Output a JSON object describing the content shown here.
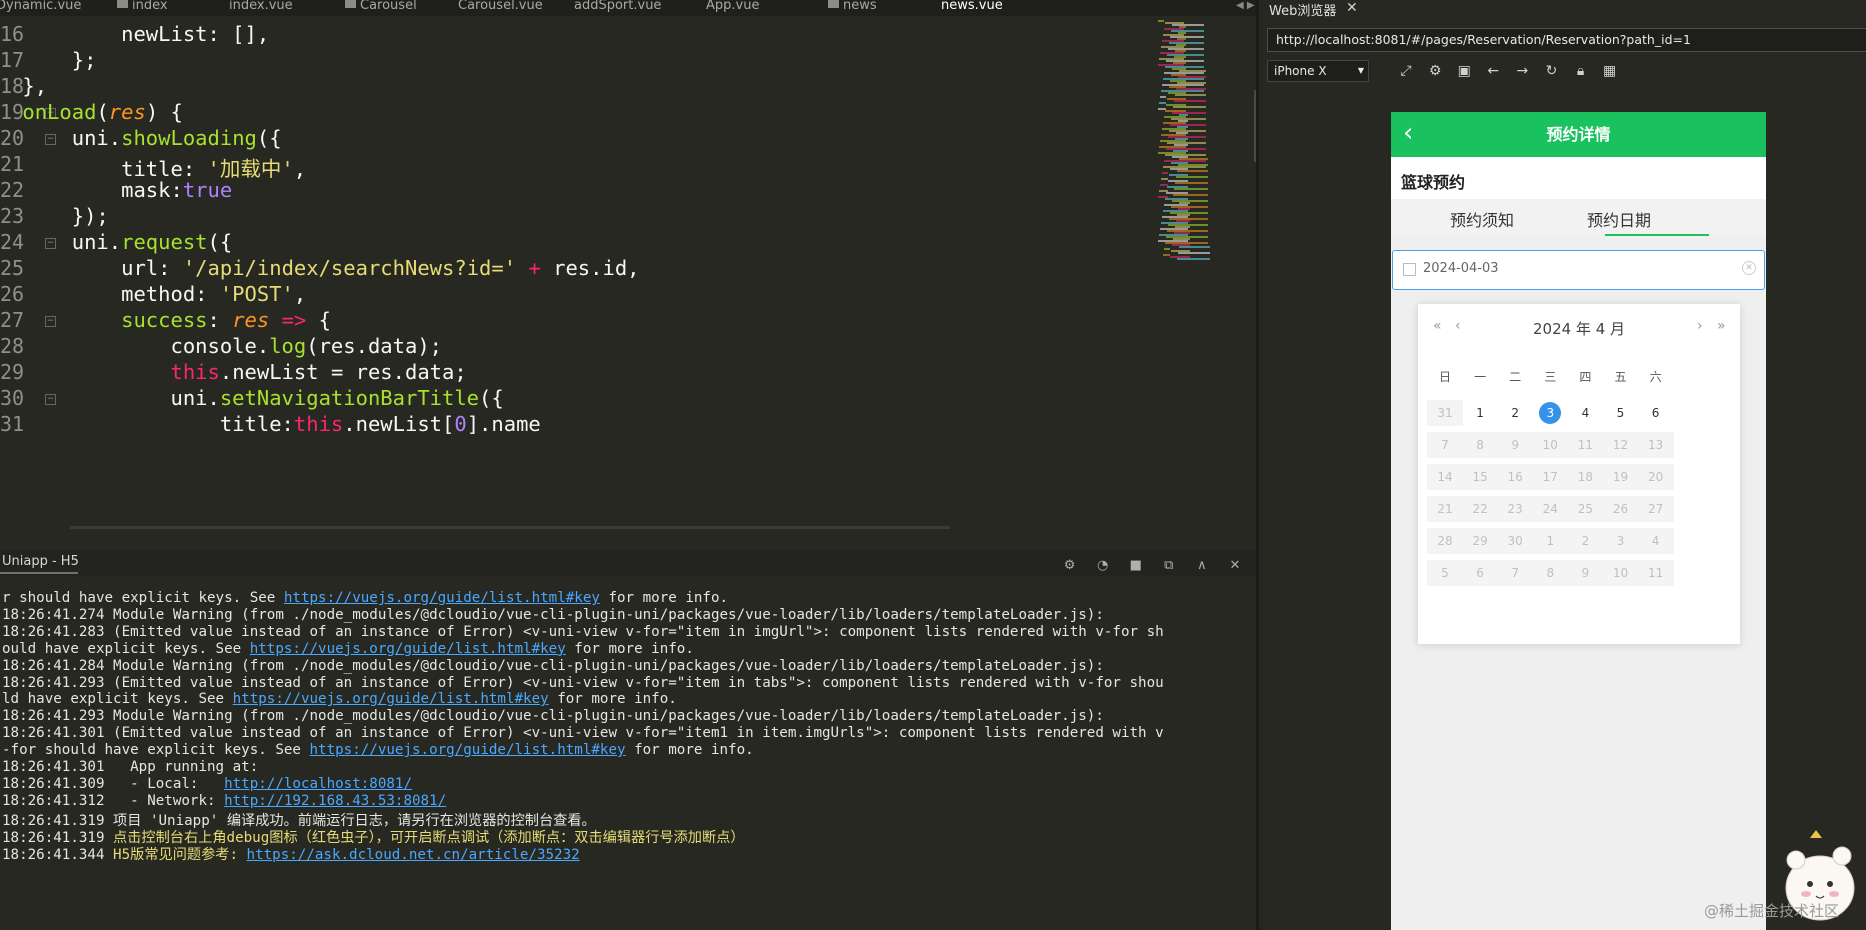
{
  "tabs": [
    {
      "label": "Dynamic.vue",
      "folder": false
    },
    {
      "label": "index",
      "folder": true
    },
    {
      "label": "index.vue",
      "folder": false
    },
    {
      "label": "Carousel",
      "folder": true
    },
    {
      "label": "Carousel.vue",
      "folder": false
    },
    {
      "label": "addSport.vue",
      "folder": false
    },
    {
      "label": "App.vue",
      "folder": false
    },
    {
      "label": "news",
      "folder": true
    },
    {
      "label": "news.vue",
      "folder": false,
      "active": true
    }
  ],
  "editor": {
    "line_numbers": [
      "16",
      "17",
      "18",
      "19",
      "20",
      "21",
      "22",
      "23",
      "24",
      "25",
      "26",
      "27",
      "28",
      "29",
      "30",
      "31"
    ],
    "lines": [
      [
        {
          "t": "            newList: [],",
          "c": "plain"
        }
      ],
      [
        {
          "t": "        };",
          "c": "plain"
        }
      ],
      [
        {
          "t": "    },",
          "c": "plain"
        }
      ],
      [
        {
          "t": "    ",
          "c": "plain"
        },
        {
          "t": "onLoad",
          "c": "func"
        },
        {
          "t": "(",
          "c": "plain"
        },
        {
          "t": "res",
          "c": "param"
        },
        {
          "t": ") {",
          "c": "plain"
        }
      ],
      [
        {
          "t": "        uni.",
          "c": "plain"
        },
        {
          "t": "showLoading",
          "c": "func"
        },
        {
          "t": "({",
          "c": "plain"
        }
      ],
      [
        {
          "t": "            title: ",
          "c": "plain"
        },
        {
          "t": "'加载中'",
          "c": "str"
        },
        {
          "t": ",",
          "c": "plain"
        }
      ],
      [
        {
          "t": "            mask:",
          "c": "plain"
        },
        {
          "t": "true",
          "c": "num"
        }
      ],
      [
        {
          "t": "        });",
          "c": "plain"
        }
      ],
      [
        {
          "t": "        uni.",
          "c": "plain"
        },
        {
          "t": "request",
          "c": "func"
        },
        {
          "t": "({",
          "c": "plain"
        }
      ],
      [
        {
          "t": "            url: ",
          "c": "plain"
        },
        {
          "t": "'/api/index/searchNews?id='",
          "c": "str"
        },
        {
          "t": " + ",
          "c": "kw"
        },
        {
          "t": "res.id,",
          "c": "plain"
        }
      ],
      [
        {
          "t": "            method: ",
          "c": "plain"
        },
        {
          "t": "'POST'",
          "c": "str"
        },
        {
          "t": ",",
          "c": "plain"
        }
      ],
      [
        {
          "t": "            ",
          "c": "plain"
        },
        {
          "t": "success",
          "c": "func"
        },
        {
          "t": ": ",
          "c": "plain"
        },
        {
          "t": "res",
          "c": "param"
        },
        {
          "t": " => ",
          "c": "kw"
        },
        {
          "t": "{",
          "c": "plain"
        }
      ],
      [
        {
          "t": "                console.",
          "c": "plain"
        },
        {
          "t": "log",
          "c": "func"
        },
        {
          "t": "(res.data);",
          "c": "plain"
        }
      ],
      [
        {
          "t": "                ",
          "c": "plain"
        },
        {
          "t": "this",
          "c": "kw"
        },
        {
          "t": ".newList = res.data;",
          "c": "plain"
        }
      ],
      [
        {
          "t": "                uni.",
          "c": "plain"
        },
        {
          "t": "setNavigationBarTitle",
          "c": "func"
        },
        {
          "t": "({",
          "c": "plain"
        }
      ],
      [
        {
          "t": "                    title:",
          "c": "plain"
        },
        {
          "t": "this",
          "c": "kw"
        },
        {
          "t": ".newList[",
          "c": "plain"
        },
        {
          "t": "0",
          "c": "num"
        },
        {
          "t": "].name",
          "c": "plain"
        }
      ]
    ]
  },
  "terminal": {
    "title": "Uniapp - H5",
    "lines": [
      [
        {
          "t": "r should have explicit keys. See "
        },
        {
          "t": "https://vuejs.org/guide/list.html#key",
          "k": "link"
        },
        {
          "t": " for more info."
        }
      ],
      [
        {
          "t": "18:26:41.274 Module Warning (from ./node_modules/@dcloudio/vue-cli-plugin-uni/packages/vue-loader/lib/loaders/templateLoader.js):"
        }
      ],
      [
        {
          "t": "18:26:41.283 (Emitted value instead of an instance of Error) <v-uni-view v-for=\"item in imgUrl\">: component lists rendered with v-for sh"
        }
      ],
      [
        {
          "t": "ould have explicit keys. See "
        },
        {
          "t": "https://vuejs.org/guide/list.html#key",
          "k": "link"
        },
        {
          "t": " for more info."
        }
      ],
      [
        {
          "t": "18:26:41.284 Module Warning (from ./node_modules/@dcloudio/vue-cli-plugin-uni/packages/vue-loader/lib/loaders/templateLoader.js):"
        }
      ],
      [
        {
          "t": "18:26:41.293 (Emitted value instead of an instance of Error) <v-uni-view v-for=\"item in tabs\">: component lists rendered with v-for shou"
        }
      ],
      [
        {
          "t": "ld have explicit keys. See "
        },
        {
          "t": "https://vuejs.org/guide/list.html#key",
          "k": "link"
        },
        {
          "t": " for more info."
        }
      ],
      [
        {
          "t": "18:26:41.293 Module Warning (from ./node_modules/@dcloudio/vue-cli-plugin-uni/packages/vue-loader/lib/loaders/templateLoader.js):"
        }
      ],
      [
        {
          "t": "18:26:41.301 (Emitted value instead of an instance of Error) <v-uni-view v-for=\"item1 in item.imgUrls\">: component lists rendered with v"
        }
      ],
      [
        {
          "t": "-for should have explicit keys. See "
        },
        {
          "t": "https://vuejs.org/guide/list.html#key",
          "k": "link"
        },
        {
          "t": " for more info."
        }
      ],
      [
        {
          "t": "18:26:41.301   App running at:"
        }
      ],
      [
        {
          "t": "18:26:41.309   - Local:   "
        },
        {
          "t": "http://localhost:8081/",
          "k": "link"
        }
      ],
      [
        {
          "t": "18:26:41.312   - Network: "
        },
        {
          "t": "http://192.168.43.53:8081/",
          "k": "link"
        }
      ],
      [
        {
          "t": "18:26:41.319 项目 'Uniapp' 编译成功。前端运行日志，请另行在浏览器的控制台查看。"
        }
      ],
      [
        {
          "t": "18:26:41.319 "
        },
        {
          "t": "点击控制台右上角debug图标（红色虫子），可开启断点调试（添加断点：双击编辑器行号添加断点）",
          "k": "yellow"
        }
      ],
      [
        {
          "t": "18:26:41.344 "
        },
        {
          "t": "H5版常见问题参考: ",
          "k": "yellow"
        },
        {
          "t": "https://ask.dcloud.net.cn/article/35232",
          "k": "link"
        }
      ]
    ]
  },
  "browser": {
    "tab_label": "Web浏览器",
    "url": "http://localhost:8081/#/pages/Reservation/Reservation?path_id=1",
    "device": "iPhone X"
  },
  "app": {
    "nav_title": "预约详情",
    "section_title": "篮球预约",
    "tabs": [
      "预约须知",
      "预约日期"
    ],
    "date_value": "2024-04-03",
    "calendar": {
      "title": "2024 年  4 月",
      "weekdays": [
        "日",
        "一",
        "二",
        "三",
        "四",
        "五",
        "六"
      ],
      "days": [
        [
          {
            "d": "31",
            "s": "dis"
          },
          {
            "d": "1",
            "s": "cur"
          },
          {
            "d": "2",
            "s": "cur"
          },
          {
            "d": "3",
            "s": "sel"
          },
          {
            "d": "4",
            "s": "cur"
          },
          {
            "d": "5",
            "s": "cur"
          },
          {
            "d": "6",
            "s": "cur"
          }
        ],
        [
          {
            "d": "7",
            "s": "dis"
          },
          {
            "d": "8",
            "s": "dis"
          },
          {
            "d": "9",
            "s": "dis"
          },
          {
            "d": "10",
            "s": "dis"
          },
          {
            "d": "11",
            "s": "dis"
          },
          {
            "d": "12",
            "s": "dis"
          },
          {
            "d": "13",
            "s": "dis"
          }
        ],
        [
          {
            "d": "14",
            "s": "dis"
          },
          {
            "d": "15",
            "s": "dis"
          },
          {
            "d": "16",
            "s": "dis"
          },
          {
            "d": "17",
            "s": "dis"
          },
          {
            "d": "18",
            "s": "dis"
          },
          {
            "d": "19",
            "s": "dis"
          },
          {
            "d": "20",
            "s": "dis"
          }
        ],
        [
          {
            "d": "21",
            "s": "dis"
          },
          {
            "d": "22",
            "s": "dis"
          },
          {
            "d": "23",
            "s": "dis"
          },
          {
            "d": "24",
            "s": "dis"
          },
          {
            "d": "25",
            "s": "dis"
          },
          {
            "d": "26",
            "s": "dis"
          },
          {
            "d": "27",
            "s": "dis"
          }
        ],
        [
          {
            "d": "28",
            "s": "dis"
          },
          {
            "d": "29",
            "s": "dis"
          },
          {
            "d": "30",
            "s": "dis"
          },
          {
            "d": "1",
            "s": "dis"
          },
          {
            "d": "2",
            "s": "dis"
          },
          {
            "d": "3",
            "s": "dis"
          },
          {
            "d": "4",
            "s": "dis"
          }
        ],
        [
          {
            "d": "5",
            "s": "dis"
          },
          {
            "d": "6",
            "s": "dis"
          },
          {
            "d": "7",
            "s": "dis"
          },
          {
            "d": "8",
            "s": "dis"
          },
          {
            "d": "9",
            "s": "dis"
          },
          {
            "d": "10",
            "s": "dis"
          },
          {
            "d": "11",
            "s": "dis"
          }
        ]
      ]
    }
  },
  "watermark": "@稀土掘金技术社区",
  "colors": {
    "accent_green": "#19c25f",
    "selected_blue": "#3592e8",
    "editor_bg": "#272822"
  }
}
